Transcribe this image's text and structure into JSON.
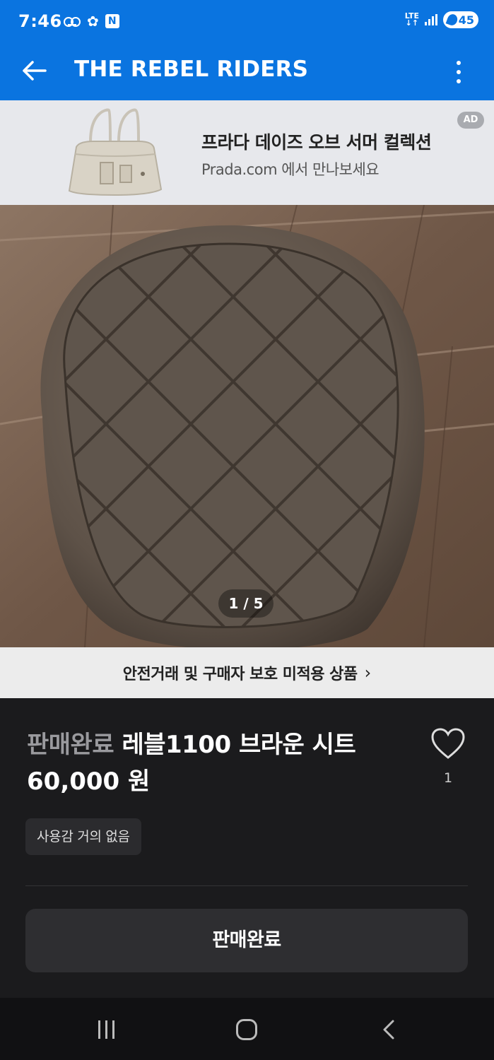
{
  "status_bar": {
    "time": "7:46",
    "network": "LTE",
    "battery": "45"
  },
  "app_bar": {
    "title": "THE REBEL RIDERS"
  },
  "ad": {
    "title": "프라다 데이즈 오브 서머 컬렉션",
    "subtitle": "Prada.com 에서 만나보세요",
    "badge": "AD"
  },
  "photo": {
    "pager": "1 / 5"
  },
  "notice": {
    "text": "안전거래 및 구매자 보호 미적용 상품",
    "chevron": "›"
  },
  "product": {
    "status": "판매완료",
    "name": "레블1100 브라운 시트",
    "price": "60,000 원",
    "like_count": "1",
    "condition": "사용감 거의 없음"
  },
  "action": {
    "sold_button_label": "판매완료"
  },
  "colors": {
    "brand_blue": "#0a74e0",
    "dark_bg": "#1b1b1d"
  }
}
